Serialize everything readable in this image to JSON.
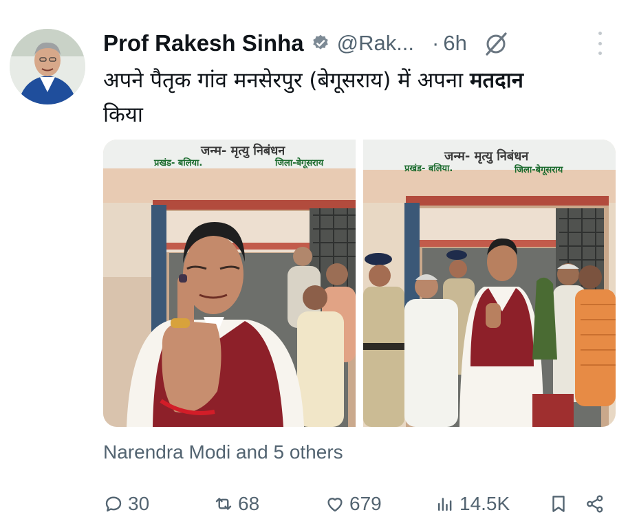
{
  "author": {
    "name": "Prof Rakesh Sinha",
    "handle": "@Rak...",
    "separator": "·",
    "time": "6h"
  },
  "tweet": {
    "text_line1_prefix": "अपने पैतृक गांव मनसेरपुर (बेगूसराय) में अपना ",
    "text_line1_bold": "मतदान",
    "text_line2": "किया"
  },
  "media": {
    "photo1_sign_title": "जन्म- मृत्यु निबंधन",
    "photo1_sign_left": "प्रखंड- बलिया.",
    "photo1_sign_right": "जिला-बेगूसराय",
    "photo2_sign_title": "जन्म- मृत्यु निबंधन",
    "photo2_sign_left": "प्रखंड- बलिया.",
    "photo2_sign_right": "जिला-बेगूसराय"
  },
  "tagged": "Narendra Modi and 5 others",
  "actions": {
    "replies": "30",
    "reposts": "68",
    "likes": "679",
    "views": "14.5K"
  },
  "icons": {
    "verified": "verified-badge-icon",
    "grok": "grok-icon",
    "more": "more-icon",
    "reply": "reply-icon",
    "repost": "repost-icon",
    "like": "heart-icon",
    "views": "views-icon",
    "bookmark": "bookmark-icon",
    "share": "share-icon"
  },
  "colors": {
    "text_primary": "#0f1419",
    "text_secondary": "#536471"
  }
}
